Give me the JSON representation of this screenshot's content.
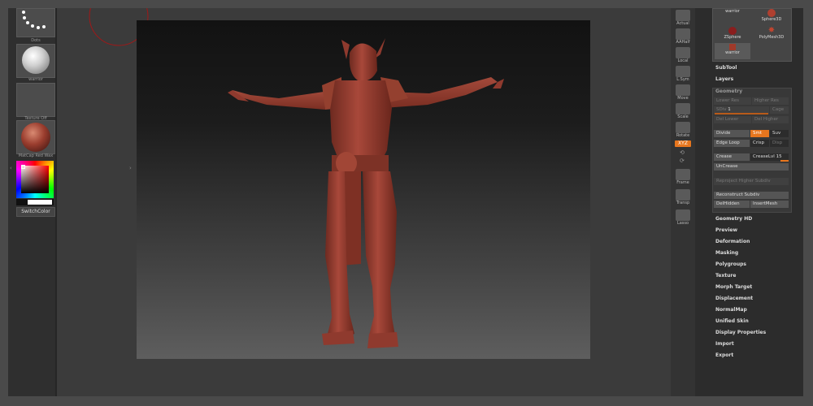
{
  "left_shelf": {
    "tiles": [
      {
        "name": "brush-tile",
        "label": "Dots"
      },
      {
        "name": "material-tile",
        "label": "warrior"
      },
      {
        "name": "texture-tile",
        "label": "Texture Off"
      },
      {
        "name": "matcap-tile",
        "label": "MatCap Red Wax"
      }
    ],
    "switch_color_label": "SwitchColor"
  },
  "shelf": {
    "buttons": [
      {
        "name": "actual",
        "label": "Actual"
      },
      {
        "name": "aahalf",
        "label": "AAHalf"
      },
      {
        "name": "local",
        "label": "Local"
      },
      {
        "name": "lsym",
        "label": "L.Sym"
      },
      {
        "name": "move",
        "label": "Move"
      },
      {
        "name": "scale",
        "label": "Scale"
      },
      {
        "name": "rotate",
        "label": "Rotate"
      },
      {
        "name": "frame",
        "label": "Frame"
      },
      {
        "name": "transp",
        "label": "Transp"
      },
      {
        "name": "lasso",
        "label": "Lasso"
      }
    ],
    "xyz_label": "XYZ"
  },
  "tool_palette": {
    "items": [
      {
        "name": "warrior",
        "label": "warrior"
      },
      {
        "name": "sphere3d",
        "label": "Sphere3D"
      },
      {
        "name": "zsphere",
        "label": "ZSphere"
      },
      {
        "name": "polymesh3d",
        "label": "PolyMesh3D"
      },
      {
        "name": "warrior-2",
        "label": "warrior"
      }
    ]
  },
  "menus": {
    "subtool": "SubTool",
    "layers": "Layers",
    "geometry": "Geometry",
    "after_geometry": [
      "Geometry HD",
      "Preview",
      "Deformation",
      "Masking",
      "Polygroups",
      "Texture",
      "Morph Target",
      "Displacement",
      "NormalMap",
      "Unified Skin",
      "Display Properties",
      "Import",
      "Export"
    ]
  },
  "geometry": {
    "lower_res": "Lower Res",
    "higher_res": "Higher Res",
    "sdiv_label": "SDiv",
    "sdiv_value": "1",
    "cage": "Cage",
    "del_lower": "Del Lower",
    "del_higher": "Del Higher",
    "divide": "Divide",
    "smt": "Smt",
    "suv": "Suv",
    "edge_loop": "Edge Loop",
    "crisp": "Crisp",
    "disp": "Disp",
    "crease": "Crease",
    "crease_lvl_label": "CreaseLvl",
    "crease_lvl_value": "15",
    "uncrease": "UnCrease",
    "reproject": "Reproject Higher Subdiv",
    "reconstruct": "Reconstruct Subdiv",
    "delhidden": "DelHidden",
    "insertmesh": "InsertMesh"
  },
  "colors": {
    "accent": "#e7761e",
    "model": "#8f3a2e",
    "background": "#3b3b3b"
  }
}
